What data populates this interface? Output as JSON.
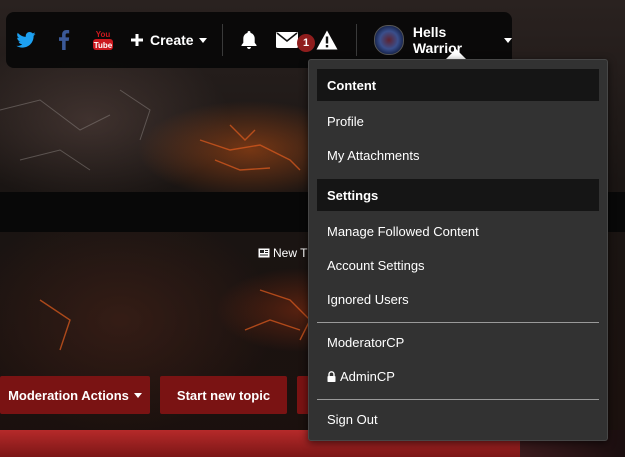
{
  "header": {
    "social": [
      {
        "icon": "twitter-icon"
      },
      {
        "icon": "facebook-icon"
      },
      {
        "icon": "youtube-icon",
        "text": "You\nTube"
      }
    ],
    "create_label": "Create",
    "notifications_icon": "bell-icon",
    "messages_icon": "envelope-icon",
    "messages_count": "1",
    "alerts_icon": "warning-icon",
    "user_name": "Hells Warrior"
  },
  "user_menu": {
    "section_content": "Content",
    "profile": "Profile",
    "attachments": "My Attachments",
    "section_settings": "Settings",
    "followed": "Manage Followed Content",
    "account_settings": "Account Settings",
    "ignored_users": "Ignored Users",
    "moderator_cp": "ModeratorCP",
    "admin_cp": "AdminCP",
    "sign_out": "Sign Out"
  },
  "page": {
    "new_topics_partial": "New T",
    "moderation_actions": "Moderation Actions",
    "start_new_topic": "Start new topic"
  },
  "colors": {
    "accent_red": "#7a1313",
    "twitter_blue": "#1da1f2",
    "facebook_blue": "#3b5998",
    "youtube_red": "#cc181e",
    "badge_red": "#8f1d1d"
  }
}
